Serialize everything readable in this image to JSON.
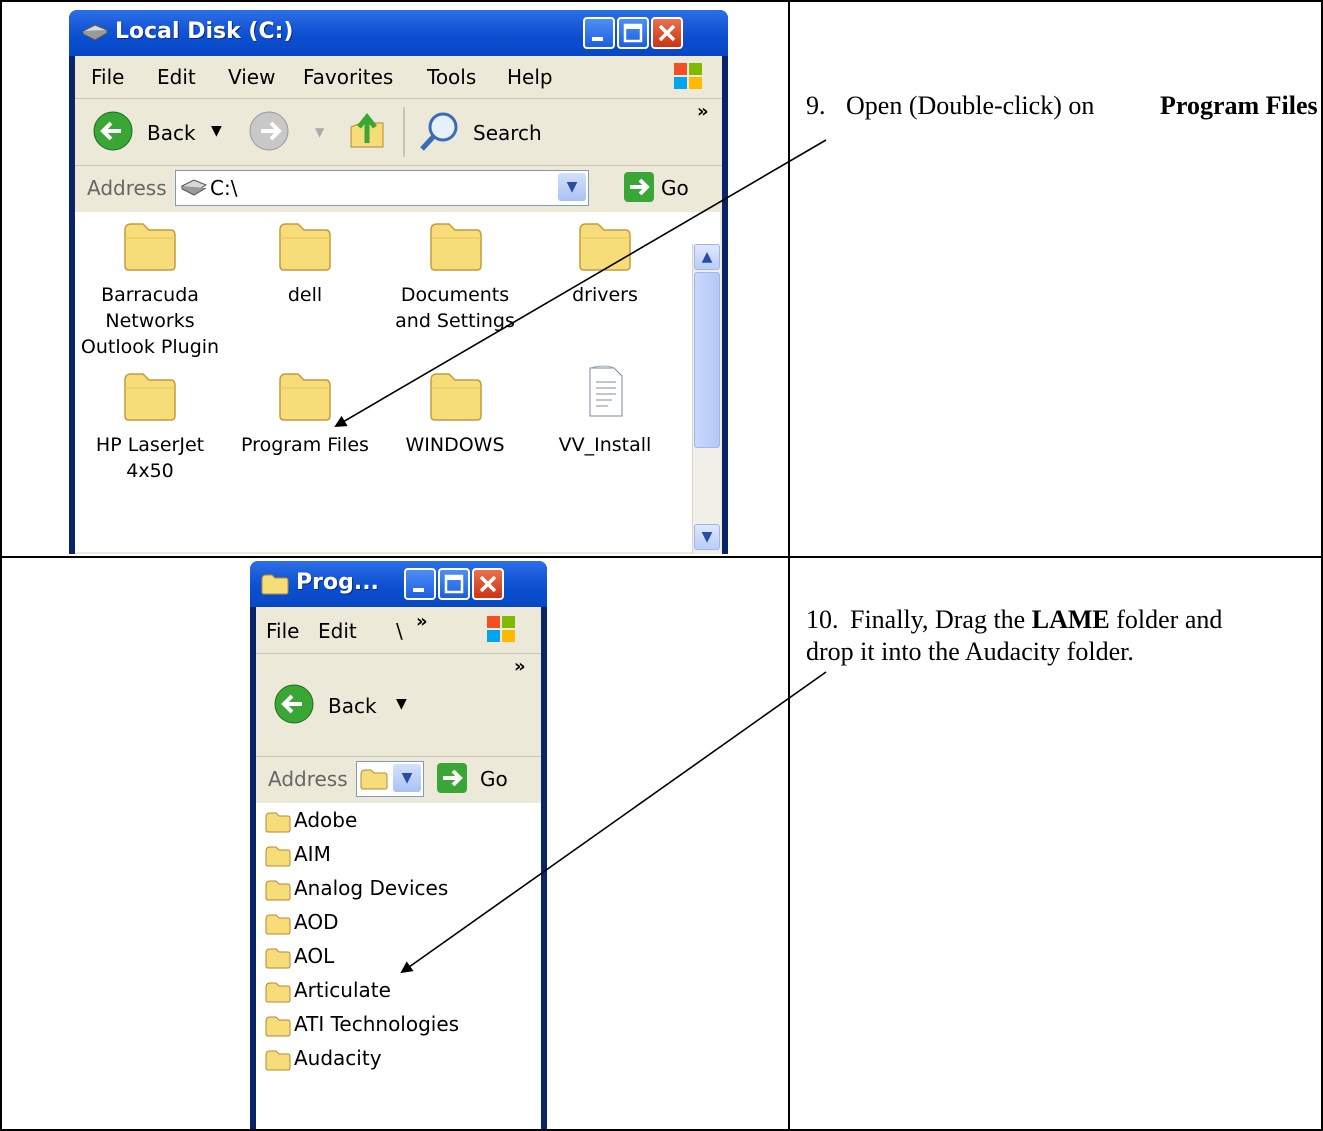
{
  "step9": {
    "number": "9.",
    "text_before": "Open (Double-click) on ",
    "bold": "Program Files"
  },
  "step10": {
    "number": "10.",
    "text_before": "Finally, Drag the ",
    "bold": "LAME",
    "text_after": " folder and drop it into the Audacity folder."
  },
  "window1": {
    "title": "Local Disk (C:)",
    "menu": [
      "File",
      "Edit",
      "View",
      "Favorites",
      "Tools",
      "Help"
    ],
    "back_label": "Back",
    "search_label": "Search",
    "chevron": "»",
    "address_label": "Address",
    "address_value": "C:\\",
    "go_label": "Go",
    "icons": [
      {
        "label": "Barracuda Networks Outlook Plugin",
        "type": "folder"
      },
      {
        "label": "dell",
        "type": "folder"
      },
      {
        "label": "Documents and Settings",
        "type": "folder"
      },
      {
        "label": "drivers",
        "type": "folder"
      },
      {
        "label": "HP LaserJet 4x50",
        "type": "folder"
      },
      {
        "label": "Program Files",
        "type": "folder"
      },
      {
        "label": "WINDOWS",
        "type": "folder"
      },
      {
        "label": "VV_Install",
        "type": "document"
      }
    ]
  },
  "window2": {
    "title": "Prog...",
    "menu": [
      "File",
      "Edit",
      "\\"
    ],
    "chevron": "»",
    "back_label": "Back",
    "address_label": "Address",
    "go_label": "Go",
    "folders": [
      "Adobe",
      "AIM",
      "Analog Devices",
      "AOD",
      "AOL",
      "Articulate",
      "ATI Technologies",
      "Audacity"
    ]
  },
  "colors": {
    "titlebar": "#0a4fd0",
    "folder": "#f7dc7a",
    "go_green": "#3aa636"
  }
}
